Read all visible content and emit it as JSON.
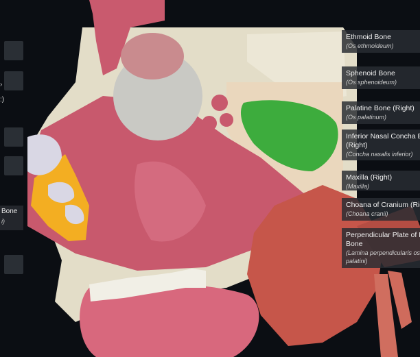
{
  "left_labels": {
    "fragment": ":)",
    "bone_label": {
      "name": "Bone",
      "latin": "i)"
    }
  },
  "labels": [
    {
      "name": "Ethmoid Bone",
      "latin": "(Os ethmoideum)"
    },
    {
      "name": "Sphenoid Bone",
      "latin": "(Os sphenoideum)"
    },
    {
      "name": "Palatine Bone (Right)",
      "latin": "(Os palatinum)"
    },
    {
      "name": "Inferior Nasal Concha Bo",
      "name2": "(Right)",
      "latin": "(Concha nasalis inferior)"
    },
    {
      "name": "Maxilla (Right)",
      "latin": "(Maxilla)"
    },
    {
      "name": "Choana of Cranium (Righ",
      "latin": "(Choana cranii)"
    },
    {
      "name": "Perpendicular Plate of P",
      "name2": "Bone",
      "latin": "(Lamina perpendicularis oss",
      "latin2": "palatini)"
    }
  ],
  "colors": {
    "background": "#0b0e13",
    "bone": "#e3ddc8",
    "soft_tissue": "#c8596d",
    "palatine_highlight": "#3dac3d",
    "concha_highlight": "#f3ae22",
    "muscle": "#c6564a",
    "eyeball": "#c9c9c4"
  }
}
